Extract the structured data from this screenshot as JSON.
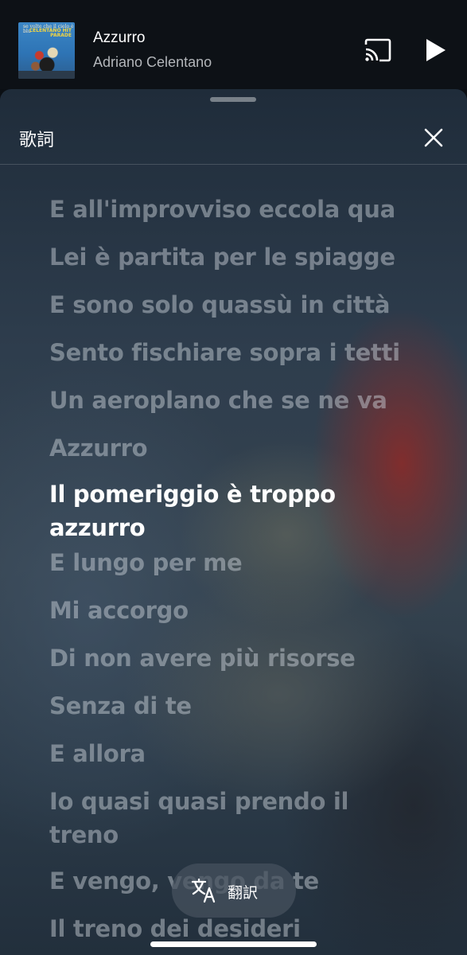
{
  "mini_player": {
    "album_art_text_top": "se volte che il cielo è blu",
    "album_art_text_right": "CELENTANO HIT PARADE",
    "title": "Azzurro",
    "artist": "Adriano Celentano",
    "cast_icon": "cast-icon",
    "play_icon": "play-icon"
  },
  "lyrics_sheet": {
    "header_title": "歌詞",
    "close_icon": "close-icon",
    "current_line_index": 6,
    "lines": [
      "E all'improvviso eccola qua",
      "Lei è partita per le spiagge",
      "E sono solo quassù in città",
      "Sento fischiare sopra i tetti",
      "Un aeroplano che se ne va",
      "Azzurro",
      "Il pomeriggio è troppo azzurro",
      "E lungo per me",
      "Mi accorgo",
      "Di non avere più risorse",
      "Senza di te",
      "E allora",
      "Io quasi quasi prendo il treno",
      "E vengo, vengo da te",
      "Il treno dei desideri"
    ]
  },
  "translate_button": {
    "icon": "translate-icon",
    "label": "翻訳"
  },
  "colors": {
    "current_lyric": "#ffffff",
    "inactive_lyric": "rgba(210,215,222,0.46)",
    "mini_player_bg": "#0d1116"
  }
}
